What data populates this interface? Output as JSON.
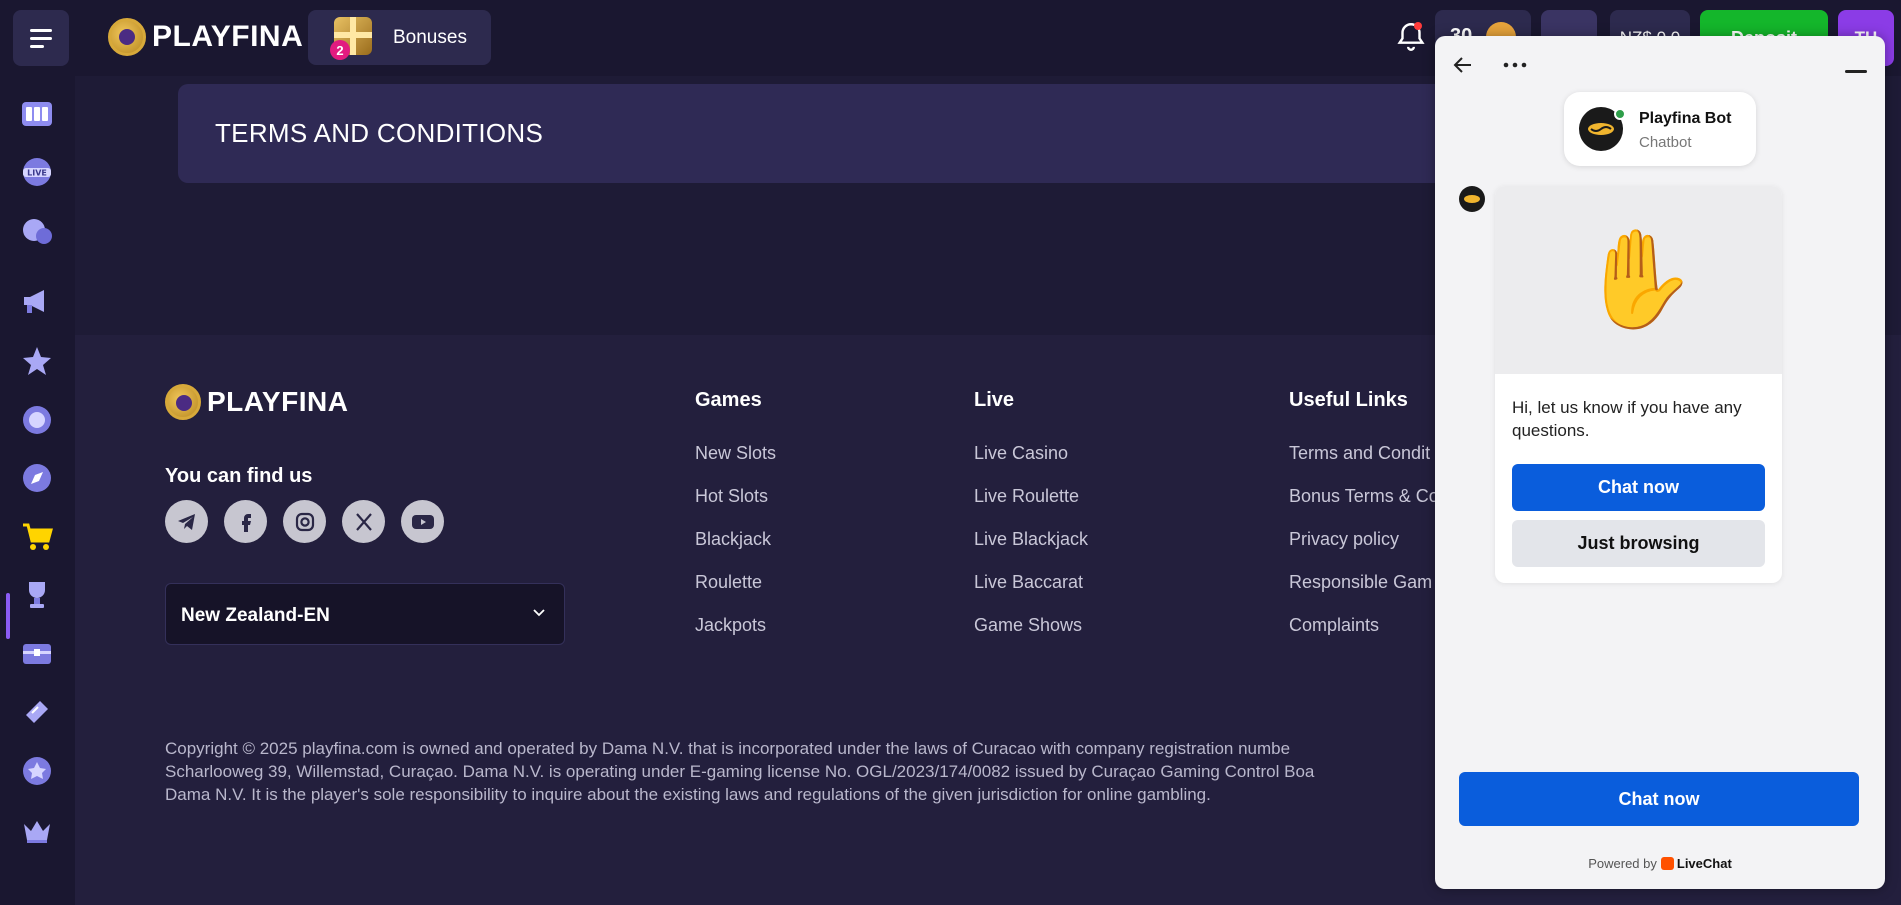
{
  "header": {
    "brand": "PLAYFINA",
    "bonuses_label": "Bonuses",
    "bonuses_count": "2",
    "points": "30",
    "balance": "NZ$ 0.0",
    "deposit_label": "Deposit",
    "avatar_initials": "TH"
  },
  "sidebar": {
    "items": [
      "slots-icon",
      "live-icon",
      "sports-icon",
      "promotions-icon",
      "star-icon",
      "loyalty-icon",
      "compass-icon",
      "shop-icon",
      "trophy-icon",
      "chest-icon",
      "ticket-icon",
      "vip-icon",
      "crown-icon"
    ],
    "active_item": "shop-icon"
  },
  "main": {
    "page_title": "TERMS AND CONDITIONS"
  },
  "footer": {
    "brand": "PLAYFINA",
    "find_us": "You can find us",
    "socials": [
      "telegram-icon",
      "facebook-icon",
      "instagram-icon",
      "x-icon",
      "youtube-icon"
    ],
    "language": "New Zealand-EN",
    "columns": [
      {
        "title": "Games",
        "links": [
          "New Slots",
          "Hot Slots",
          "Blackjack",
          "Roulette",
          "Jackpots"
        ]
      },
      {
        "title": "Live",
        "links": [
          "Live Casino",
          "Live Roulette",
          "Live Blackjack",
          "Live Baccarat",
          "Game Shows"
        ]
      },
      {
        "title": "Useful Links",
        "links": [
          "Terms and Condit",
          "Bonus Terms & Co",
          "Privacy policy",
          "Responsible Gam",
          "Complaints"
        ]
      }
    ],
    "copyright_lines": [
      "Copyright © 2025 playfina.com is owned and operated by Dama N.V. that is incorporated under the laws of Curacao with company registration numbe",
      "Scharlooweg 39, Willemstad, Curaçao. Dama N.V. is operating under E-gaming license No. OGL/2023/174/0082 issued by Curaçao Gaming Control Boa",
      "Dama N.V. It is the player's sole responsibility to inquire about the existing laws and regulations of the given jurisdiction for online gambling."
    ]
  },
  "chat": {
    "bot_name": "Playfina Bot",
    "bot_role": "Chatbot",
    "wave_emoji": "✋",
    "message": "Hi, let us know if you have any questions.",
    "chat_now_label": "Chat now",
    "just_browsing_label": "Just browsing",
    "footer_chat_now": "Chat now",
    "powered_by": "Powered by",
    "powered_brand": "LiveChat"
  },
  "colors": {
    "background": "#1e1b36",
    "panel": "#2d2a4e",
    "deposit": "#14b62b",
    "avatar": "#8b3ce6",
    "chat_primary": "#0a5ddc"
  }
}
